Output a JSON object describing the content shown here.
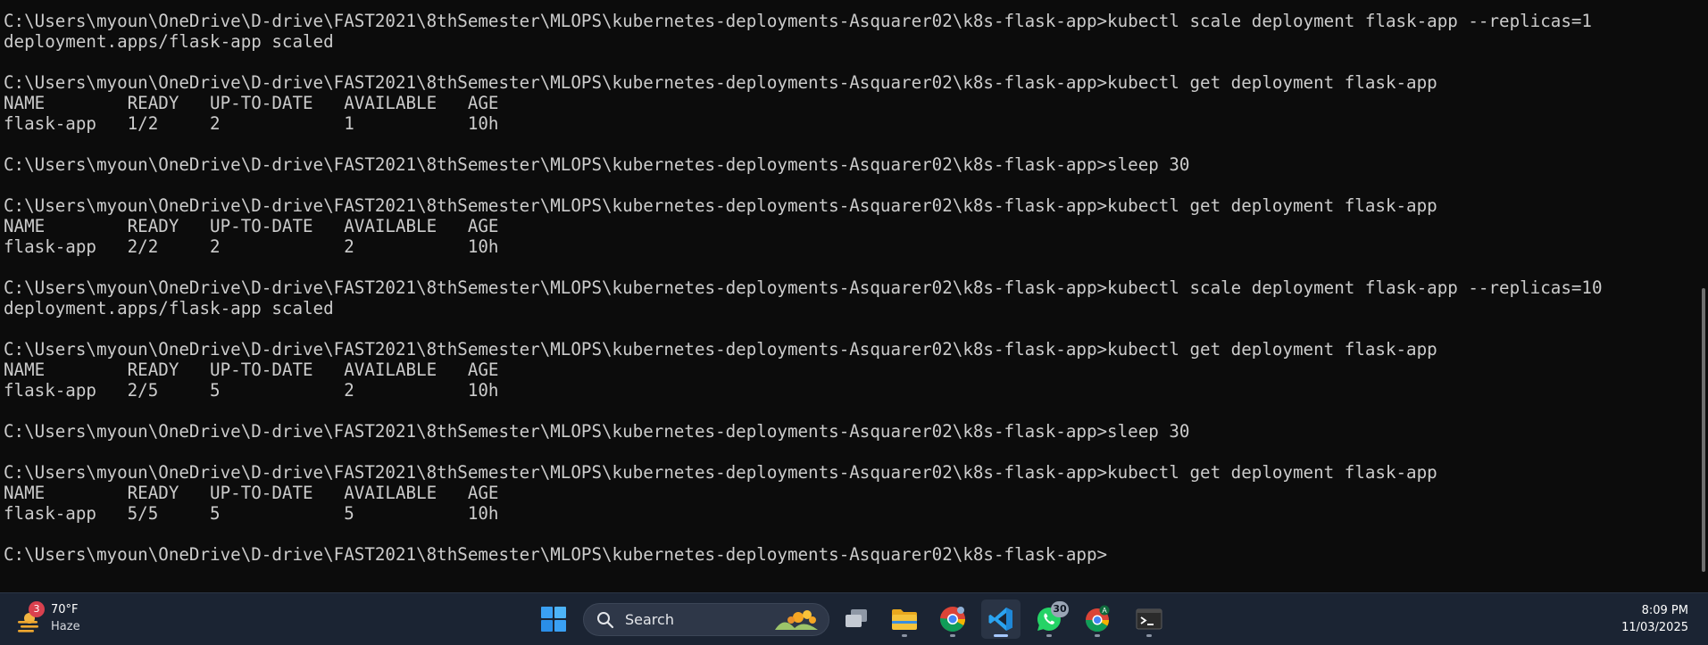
{
  "terminal": {
    "lines": [
      "C:\\Users\\myoun\\OneDrive\\D-drive\\FAST2021\\8thSemester\\MLOPS\\kubernetes-deployments-Asquarer02\\k8s-flask-app>kubectl scale deployment flask-app --replicas=1",
      "deployment.apps/flask-app scaled",
      "",
      "C:\\Users\\myoun\\OneDrive\\D-drive\\FAST2021\\8thSemester\\MLOPS\\kubernetes-deployments-Asquarer02\\k8s-flask-app>kubectl get deployment flask-app",
      "NAME        READY   UP-TO-DATE   AVAILABLE   AGE",
      "flask-app   1/2     2            1           10h",
      "",
      "C:\\Users\\myoun\\OneDrive\\D-drive\\FAST2021\\8thSemester\\MLOPS\\kubernetes-deployments-Asquarer02\\k8s-flask-app>sleep 30",
      "",
      "C:\\Users\\myoun\\OneDrive\\D-drive\\FAST2021\\8thSemester\\MLOPS\\kubernetes-deployments-Asquarer02\\k8s-flask-app>kubectl get deployment flask-app",
      "NAME        READY   UP-TO-DATE   AVAILABLE   AGE",
      "flask-app   2/2     2            2           10h",
      "",
      "C:\\Users\\myoun\\OneDrive\\D-drive\\FAST2021\\8thSemester\\MLOPS\\kubernetes-deployments-Asquarer02\\k8s-flask-app>kubectl scale deployment flask-app --replicas=10",
      "deployment.apps/flask-app scaled",
      "",
      "C:\\Users\\myoun\\OneDrive\\D-drive\\FAST2021\\8thSemester\\MLOPS\\kubernetes-deployments-Asquarer02\\k8s-flask-app>kubectl get deployment flask-app",
      "NAME        READY   UP-TO-DATE   AVAILABLE   AGE",
      "flask-app   2/5     5            2           10h",
      "",
      "C:\\Users\\myoun\\OneDrive\\D-drive\\FAST2021\\8thSemester\\MLOPS\\kubernetes-deployments-Asquarer02\\k8s-flask-app>sleep 30",
      "",
      "C:\\Users\\myoun\\OneDrive\\D-drive\\FAST2021\\8thSemester\\MLOPS\\kubernetes-deployments-Asquarer02\\k8s-flask-app>kubectl get deployment flask-app",
      "NAME        READY   UP-TO-DATE   AVAILABLE   AGE",
      "flask-app   5/5     5            5           10h",
      "",
      "C:\\Users\\myoun\\OneDrive\\D-drive\\FAST2021\\8thSemester\\MLOPS\\kubernetes-deployments-Asquarer02\\k8s-flask-app>"
    ]
  },
  "taskbar": {
    "weather": {
      "badge": "3",
      "temp": "70°F",
      "condition": "Haze"
    },
    "search": {
      "label": "Search"
    },
    "apps": [
      {
        "name": "start-button",
        "icon": "windows-icon"
      },
      {
        "name": "task-view-button",
        "icon": "task-view-icon"
      },
      {
        "name": "file-explorer-button",
        "icon": "folder-icon"
      },
      {
        "name": "chrome-button",
        "icon": "chrome-icon"
      },
      {
        "name": "vscode-button",
        "icon": "vscode-icon"
      },
      {
        "name": "whatsapp-button",
        "icon": "whatsapp-icon",
        "badge": "30"
      },
      {
        "name": "chrome-profile-button",
        "icon": "chrome-profile-icon",
        "profile": "A"
      },
      {
        "name": "terminal-button",
        "icon": "terminal-icon"
      }
    ],
    "clock": {
      "time": "8:09 PM",
      "date": "11/03/2025"
    }
  },
  "colors": {
    "terminal_bg": "#0c0c0c",
    "terminal_fg": "#cccccc",
    "taskbar_bg": "#1b2433",
    "accent": "#a6c8ff"
  }
}
